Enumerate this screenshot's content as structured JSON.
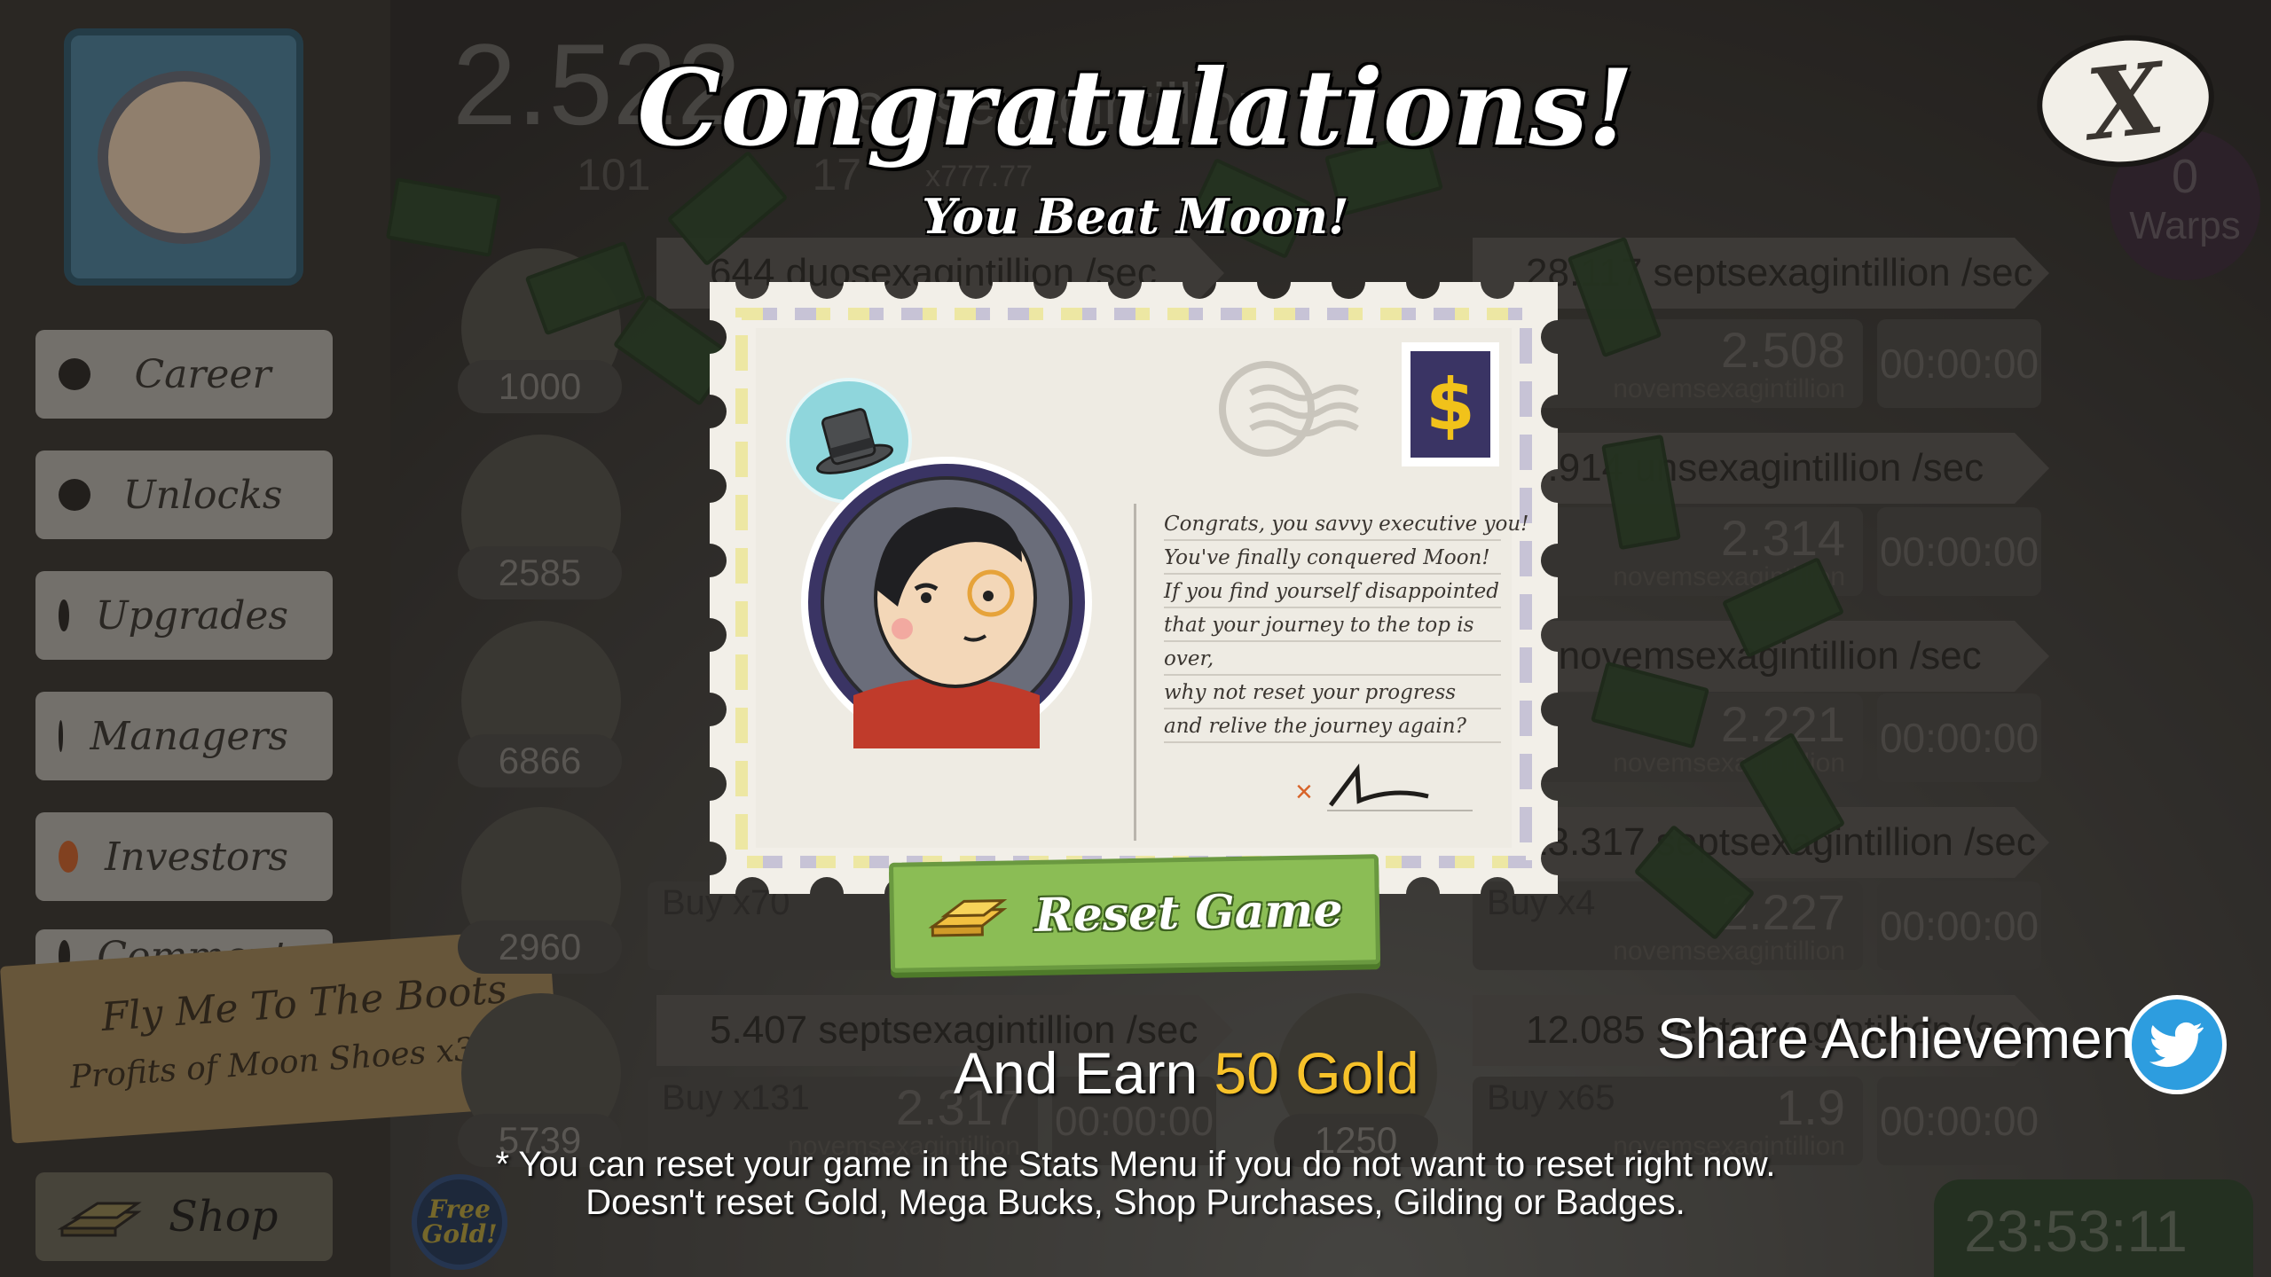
{
  "modal": {
    "title": "Congratulations!",
    "subtitle": "You Beat Moon!",
    "close_label": "X",
    "letter_lines": [
      "Congrats, you savvy executive you!",
      "You've finally conquered Moon!",
      "If you find yourself disappointed",
      "that your journey to the top is",
      "over,",
      "why not reset your progress",
      "and relive the journey again?"
    ],
    "stamp_symbol": "$",
    "signature_mark": "×",
    "reset_button": "Reset Game",
    "earn_prefix": "And Earn",
    "earn_gold": "50 Gold",
    "share_label": "Share Achievement",
    "footnote_line1": "* You can reset your game in the Stats Menu if you do not want to reset right now.",
    "footnote_line2": "Doesn't reset Gold, Mega Bucks, Shop Purchases, Gilding or Badges."
  },
  "background": {
    "money_value": "2.522",
    "money_unit": "novemsexagintillion",
    "gold_count": "101",
    "mega_bucks": "17",
    "multiplier": "x777.77",
    "sidebar_items": [
      "Career",
      "Unlocks",
      "Upgrades",
      "Managers",
      "Investors",
      "Comment"
    ],
    "event_title": "Fly Me To The Boots",
    "event_desc": "Profits of Moon Shoes x3.5",
    "shop_label": "Shop",
    "free_gold_label": "Free Gold!",
    "warps_count": "0",
    "warps_label": "Warps",
    "clock": "23:53:11",
    "business_counts": [
      "1000",
      "2585",
      "6866",
      "2960",
      "5739",
      "1250"
    ],
    "rates": [
      "644 duosexagintillion /sec",
      "28.117 septsexagintillion /sec",
      "8.914 unsexagintillion /sec",
      "6 novemsexagintillion /sec",
      "13.317 septsexagintillion /sec",
      "5.407 septsexagintillion /sec",
      "12.085 septsexagintillion /sec"
    ],
    "buy_labels": [
      "Buy x70",
      "Buy x4",
      "Buy x131",
      "Buy x65"
    ],
    "panel_values": [
      "2.508",
      "2.314",
      "2.221",
      "2.227",
      "2.317",
      "1.9"
    ],
    "panel_unit": "novemsexagintillion",
    "timer": "00:00:00"
  },
  "colors": {
    "reset_green": "#8bbd55",
    "gold_text": "#f7c22a",
    "twitter_blue": "#2d9ddf",
    "stamp_purple": "#3a3464"
  },
  "icons": {
    "close": "close-x-icon",
    "twitter": "twitter-bird-icon",
    "gold": "gold-bars-icon",
    "postmark": "postmark-icon",
    "stamp": "dollar-stamp-icon"
  }
}
